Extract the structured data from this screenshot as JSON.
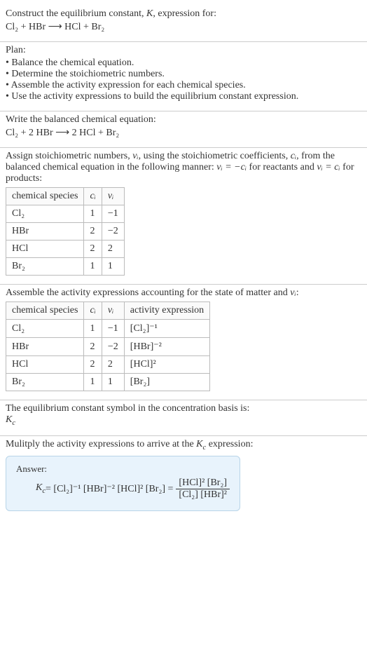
{
  "s1": {
    "title": "Construct the equilibrium constant, K, expression for:",
    "eq": "Cl₂ + HBr ⟶ HCl + Br₂"
  },
  "s2": {
    "title": "Plan:",
    "items": [
      "• Balance the chemical equation.",
      "• Determine the stoichiometric numbers.",
      "• Assemble the activity expression for each chemical species.",
      "• Use the activity expressions to build the equilibrium constant expression."
    ]
  },
  "s3": {
    "title": "Write the balanced chemical equation:",
    "eq": "Cl₂ + 2 HBr ⟶ 2 HCl + Br₂"
  },
  "s4": {
    "pre": "Assign stoichiometric numbers, ",
    "nu": "νᵢ",
    "mid1": ", using the stoichiometric coefficients, ",
    "ci": "cᵢ",
    "mid2": ", from the balanced chemical equation in the following manner: ",
    "rel1": "νᵢ = −cᵢ",
    "mid3": " for reactants and ",
    "rel2": "νᵢ = cᵢ",
    "post": " for products:",
    "headers": [
      "chemical species",
      "cᵢ",
      "νᵢ"
    ],
    "rows": [
      {
        "sp": "Cl₂",
        "c": "1",
        "v": "−1"
      },
      {
        "sp": "HBr",
        "c": "2",
        "v": "−2"
      },
      {
        "sp": "HCl",
        "c": "2",
        "v": "2"
      },
      {
        "sp": "Br₂",
        "c": "1",
        "v": "1"
      }
    ]
  },
  "s5": {
    "title": "Assemble the activity expressions accounting for the state of matter and νᵢ:",
    "headers": [
      "chemical species",
      "cᵢ",
      "νᵢ",
      "activity expression"
    ],
    "rows": [
      {
        "sp": "Cl₂",
        "c": "1",
        "v": "−1",
        "a": "[Cl₂]⁻¹"
      },
      {
        "sp": "HBr",
        "c": "2",
        "v": "−2",
        "a": "[HBr]⁻²"
      },
      {
        "sp": "HCl",
        "c": "2",
        "v": "2",
        "a": "[HCl]²"
      },
      {
        "sp": "Br₂",
        "c": "1",
        "v": "1",
        "a": "[Br₂]"
      }
    ]
  },
  "s6": {
    "title": "The equilibrium constant symbol in the concentration basis is:",
    "sym": "K_c"
  },
  "s7": {
    "title": "Mulitply the activity expressions to arrive at the K_c expression:",
    "answer_label": "Answer:",
    "kc": "K_c",
    "lhs": " = [Cl₂]⁻¹ [HBr]⁻² [HCl]² [Br₂] = ",
    "num": "[HCl]² [Br₂]",
    "den": "[Cl₂] [HBr]²"
  }
}
